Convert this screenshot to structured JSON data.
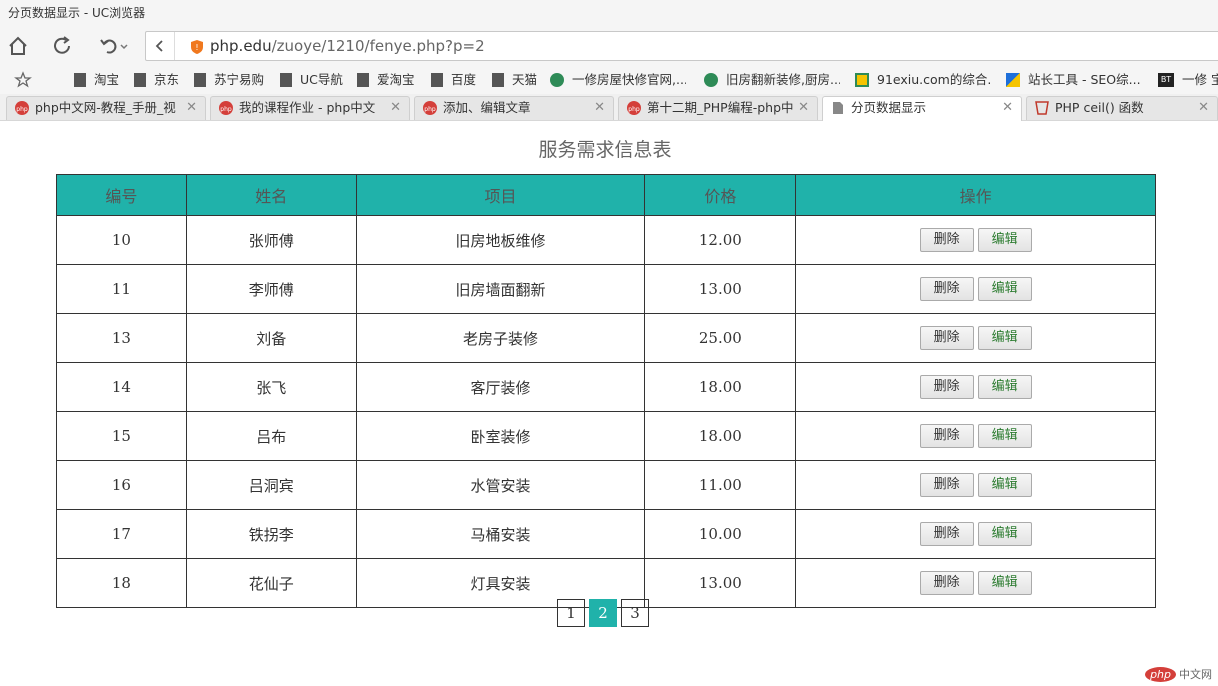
{
  "window": {
    "title": "分页数据显示 - UC浏览器"
  },
  "address": {
    "url_host": "php.edu",
    "url_path": "/zuoye/1210/fenye.php?p=2"
  },
  "bookmarks": [
    "淘宝",
    "京东",
    "苏宁易购",
    "UC导航",
    "爱淘宝",
    "百度",
    "天猫",
    "一修房屋快修官网,...",
    "旧房翻新装修,厨房...",
    "91exiu.com的综合...",
    "站长工具 - SEO综...",
    "一修 宝"
  ],
  "tabs": [
    {
      "label": "php中文网-教程_手册_视",
      "active": false
    },
    {
      "label": "我的课程作业 - php中文",
      "active": false
    },
    {
      "label": "添加、编辑文章",
      "active": false
    },
    {
      "label": "第十二期_PHP编程-php中",
      "active": false
    },
    {
      "label": "分页数据显示",
      "active": true
    },
    {
      "label": "PHP ceil() 函数",
      "active": false
    }
  ],
  "page": {
    "caption": "服务需求信息表",
    "headers": [
      "编号",
      "姓名",
      "项目",
      "价格",
      "操作"
    ],
    "delete_label": "删除",
    "edit_label": "编辑",
    "rows": [
      {
        "id": "10",
        "name": "张师傅",
        "project": "旧房地板维修",
        "price": "12.00"
      },
      {
        "id": "11",
        "name": "李师傅",
        "project": "旧房墙面翻新",
        "price": "13.00"
      },
      {
        "id": "13",
        "name": "刘备",
        "project": "老房子装修",
        "price": "25.00"
      },
      {
        "id": "14",
        "name": "张飞",
        "project": "客厅装修",
        "price": "18.00"
      },
      {
        "id": "15",
        "name": "吕布",
        "project": "卧室装修",
        "price": "18.00"
      },
      {
        "id": "16",
        "name": "吕洞宾",
        "project": "水管安装",
        "price": "11.00"
      },
      {
        "id": "17",
        "name": "铁拐李",
        "project": "马桶安装",
        "price": "10.00"
      },
      {
        "id": "18",
        "name": "花仙子",
        "project": "灯具安装",
        "price": "13.00"
      }
    ],
    "pages": [
      "1",
      "2",
      "3"
    ],
    "current_page": "2"
  },
  "watermark": {
    "brand": "php",
    "text": "中文网"
  },
  "colors": {
    "accent": "#20b2aa"
  }
}
